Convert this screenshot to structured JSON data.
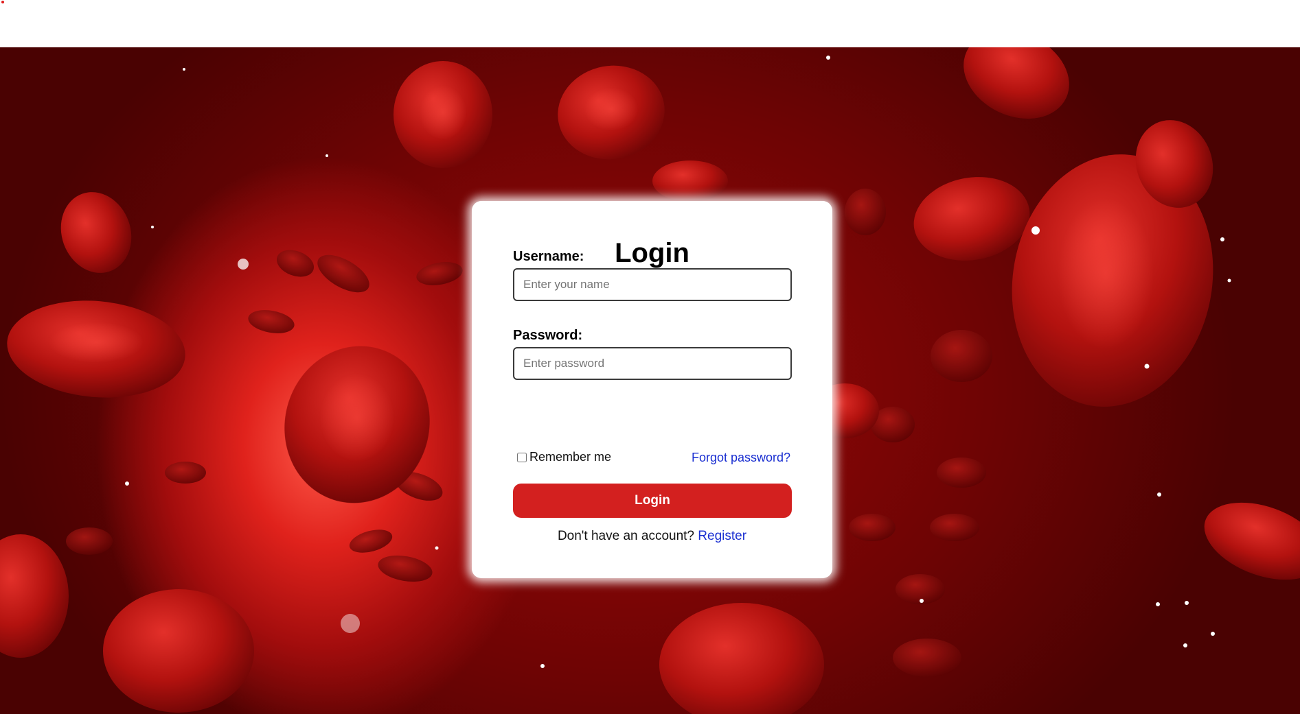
{
  "login_card": {
    "title": "Login",
    "username_label": "Username:",
    "username_placeholder": "Enter your name",
    "username_value": "",
    "password_label": "Password:",
    "password_placeholder": "Enter password",
    "password_value": "",
    "remember_label": "Remember me",
    "remember_checked": false,
    "forgot_link": "Forgot password?",
    "submit_label": "Login",
    "register_prompt": "Don't have an account?",
    "register_link": "Register"
  },
  "colors": {
    "primary_button": "#d3201f",
    "link": "#1a2fd1",
    "background_theme": "#8b0000"
  },
  "background": {
    "image_subject": "red-blood-cells"
  }
}
